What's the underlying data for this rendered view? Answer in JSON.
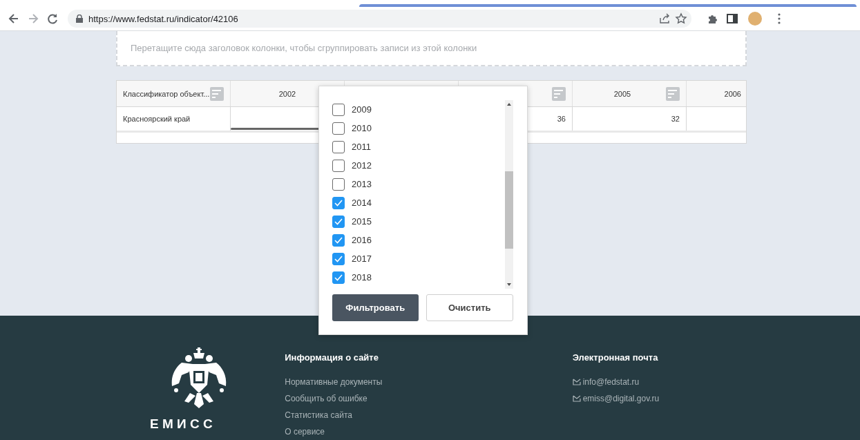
{
  "browser": {
    "url": "https://www.fedstat.ru/indicator/42106"
  },
  "group_panel": {
    "hint": "Перетащите сюда заголовок колонки, чтобы сгруппировать записи из этой колонки"
  },
  "grid": {
    "columns": [
      {
        "label": "Классификатор объект...",
        "filter": true
      },
      {
        "label": "2002"
      },
      {},
      {
        "filter": true
      },
      {
        "label": "2005",
        "filter": true
      },
      {
        "label": "2006"
      }
    ],
    "rows": [
      {
        "cells": [
          {
            "kind": "text",
            "text": "Красноярский край"
          },
          {
            "kind": "bar"
          },
          {
            "kind": "empty"
          },
          {
            "kind": "number",
            "text": "36"
          },
          {
            "kind": "number",
            "text": "32"
          },
          {
            "kind": "empty"
          }
        ]
      }
    ]
  },
  "filter_popup": {
    "items": [
      {
        "label": "2009",
        "checked": false
      },
      {
        "label": "2010",
        "checked": false
      },
      {
        "label": "2011",
        "checked": false
      },
      {
        "label": "2012",
        "checked": false
      },
      {
        "label": "2013",
        "checked": false
      },
      {
        "label": "2014",
        "checked": true
      },
      {
        "label": "2015",
        "checked": true
      },
      {
        "label": "2016",
        "checked": true
      },
      {
        "label": "2017",
        "checked": true
      },
      {
        "label": "2018",
        "checked": true
      }
    ],
    "buttons": [
      {
        "label": "Фильтровать",
        "kind": "primary"
      },
      {
        "label": "Очистить",
        "kind": "secondary"
      }
    ]
  },
  "footer": {
    "logo_text": "Е М И С С",
    "sections": [
      {
        "title": "Информация о сайте",
        "kind": "links",
        "links": [
          "Нормативные документы",
          "Сообщить об ошибке",
          "Статистика сайта",
          "О сервисе"
        ]
      },
      {
        "title": "Электронная почта",
        "kind": "emails",
        "links": [
          "info@fedstat.ru",
          "emiss@digital.gov.ru"
        ]
      }
    ]
  }
}
